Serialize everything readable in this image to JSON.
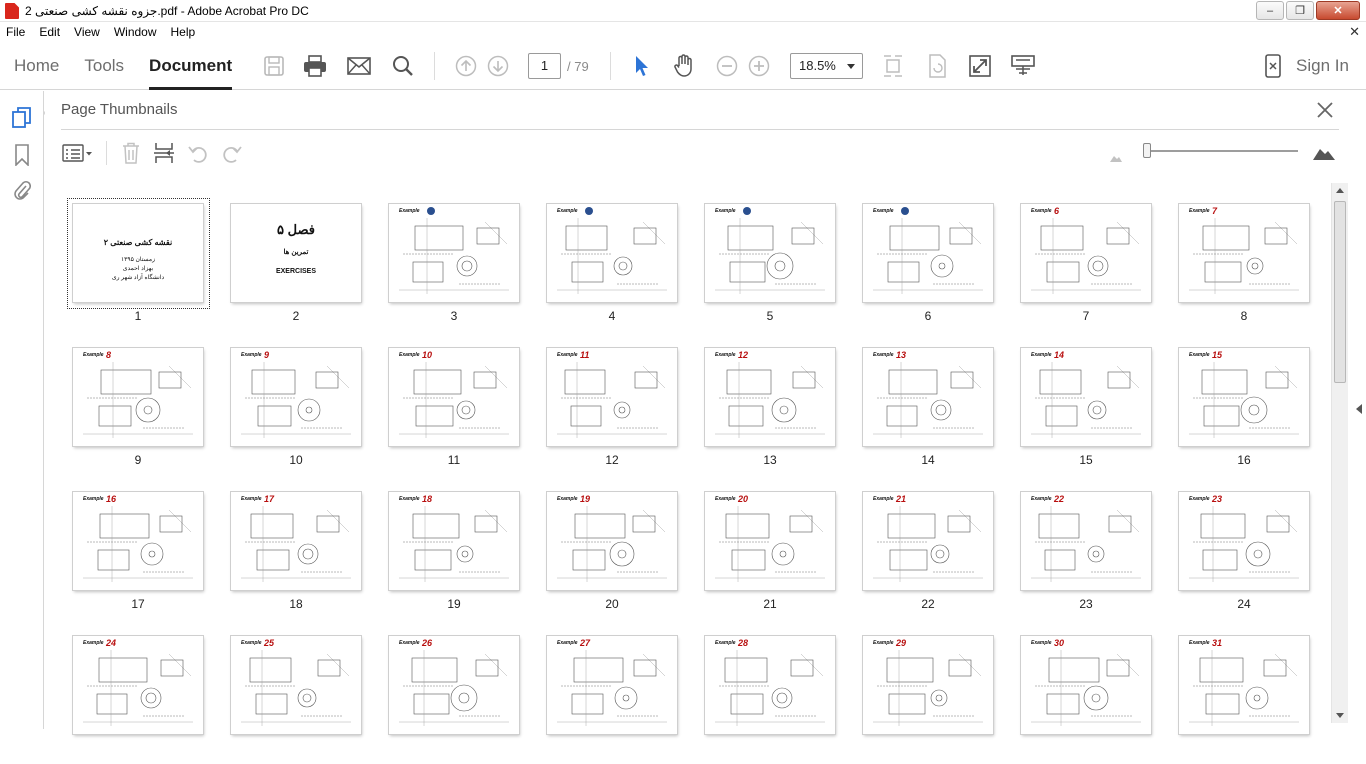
{
  "window": {
    "title": "جزوه نقشه کشی صنعتی 2.pdf - Adobe Acrobat Pro DC",
    "buttons": [
      "minimize",
      "maximize",
      "close"
    ]
  },
  "menu": [
    "File",
    "Edit",
    "View",
    "Window",
    "Help"
  ],
  "toolbar": {
    "tabs": [
      {
        "label": "Home"
      },
      {
        "label": "Tools"
      },
      {
        "label": "Document"
      }
    ],
    "active_tab": "Document",
    "page_current": "1",
    "page_total": "/ 79",
    "zoom": "18.5%",
    "sign_in": "Sign In",
    "icons": [
      "save-icon",
      "print-icon",
      "email-icon",
      "search-icon",
      "page-up-icon",
      "page-down-icon",
      "select-arrow-icon",
      "hand-icon",
      "zoom-out-icon",
      "zoom-in-icon",
      "fit-page-icon",
      "rotate-icon",
      "full-screen-icon",
      "read-mode-icon"
    ]
  },
  "rail": {
    "icons": [
      "page-thumbnails-icon",
      "bookmarks-icon",
      "attachments-icon"
    ]
  },
  "panel": {
    "title": "Page Thumbnails",
    "tools": [
      "options-menu-icon",
      "delete-icon",
      "insert-page-icon",
      "undo-icon",
      "redo-icon"
    ],
    "thumbnail_size": 0.0
  },
  "cover": {
    "title": "نقشه کشی صنعتی ۲",
    "line1": "زمستان ۱۳۹۵",
    "line2": "بهزاد احمدی",
    "line3": "دانشگاه آزاد شهر ری"
  },
  "chapter_page": {
    "title": "فصل ۵",
    "subtitle": "تمرین ها",
    "english": "EXERCISES"
  },
  "example_label": "Example",
  "thumbnails": [
    {
      "page": "1",
      "kind": "cover",
      "selected": true
    },
    {
      "page": "2",
      "kind": "chapter"
    },
    {
      "page": "3",
      "kind": "example",
      "example": "",
      "badge": true
    },
    {
      "page": "4",
      "kind": "example",
      "example": "",
      "badge": true
    },
    {
      "page": "5",
      "kind": "example",
      "example": "",
      "badge": true
    },
    {
      "page": "6",
      "kind": "example",
      "example": "",
      "badge": true
    },
    {
      "page": "7",
      "kind": "example",
      "example": "6"
    },
    {
      "page": "8",
      "kind": "example",
      "example": "7"
    },
    {
      "page": "9",
      "kind": "example",
      "example": "8"
    },
    {
      "page": "10",
      "kind": "example",
      "example": "9"
    },
    {
      "page": "11",
      "kind": "example",
      "example": "10"
    },
    {
      "page": "12",
      "kind": "example",
      "example": "11"
    },
    {
      "page": "13",
      "kind": "example",
      "example": "12"
    },
    {
      "page": "14",
      "kind": "example",
      "example": "13"
    },
    {
      "page": "15",
      "kind": "example",
      "example": "14"
    },
    {
      "page": "16",
      "kind": "example",
      "example": "15"
    },
    {
      "page": "17",
      "kind": "example",
      "example": "16"
    },
    {
      "page": "18",
      "kind": "example",
      "example": "17"
    },
    {
      "page": "19",
      "kind": "example",
      "example": "18"
    },
    {
      "page": "20",
      "kind": "example",
      "example": "19"
    },
    {
      "page": "21",
      "kind": "example",
      "example": "20"
    },
    {
      "page": "22",
      "kind": "example",
      "example": "21"
    },
    {
      "page": "23",
      "kind": "example",
      "example": "22"
    },
    {
      "page": "24",
      "kind": "example",
      "example": "23"
    },
    {
      "page": "",
      "kind": "example",
      "example": "24"
    },
    {
      "page": "",
      "kind": "example",
      "example": "25"
    },
    {
      "page": "",
      "kind": "example",
      "example": "26"
    },
    {
      "page": "",
      "kind": "example",
      "example": "27"
    },
    {
      "page": "",
      "kind": "example",
      "example": "28"
    },
    {
      "page": "",
      "kind": "example",
      "example": "29"
    },
    {
      "page": "",
      "kind": "example",
      "example": "30"
    },
    {
      "page": "",
      "kind": "example",
      "example": "31"
    }
  ]
}
